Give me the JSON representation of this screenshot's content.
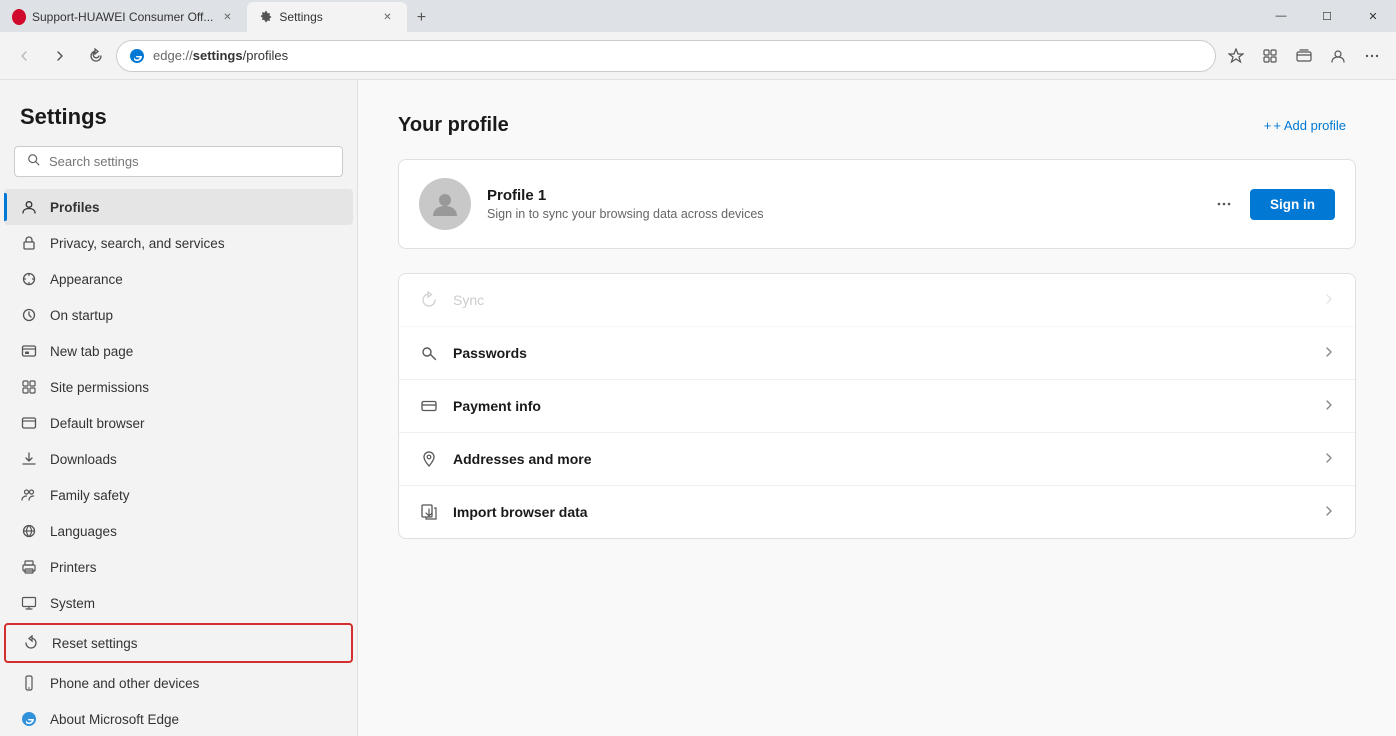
{
  "titlebar": {
    "tabs": [
      {
        "id": "tab-huawei",
        "label": "Support-HUAWEI Consumer Off...",
        "favicon_type": "huawei",
        "active": false
      },
      {
        "id": "tab-settings",
        "label": "Settings",
        "favicon_type": "settings",
        "active": true
      }
    ],
    "new_tab_label": "+",
    "window_controls": {
      "minimize": "—",
      "maximize": "☐",
      "close": "✕"
    }
  },
  "toolbar": {
    "back_disabled": true,
    "forward_disabled": false,
    "refresh_label": "↺",
    "address": "edge://settings/profiles",
    "address_protocol": "edge://",
    "address_path": "settings",
    "address_rest": "/profiles",
    "star_label": "☆",
    "collections_label": "⊞",
    "wallet_label": "◈",
    "profile_label": "◯",
    "more_label": "..."
  },
  "sidebar": {
    "title": "Settings",
    "search_placeholder": "Search settings",
    "nav_items": [
      {
        "id": "profiles",
        "label": "Profiles",
        "icon": "person",
        "active": true
      },
      {
        "id": "privacy",
        "label": "Privacy, search, and services",
        "icon": "lock"
      },
      {
        "id": "appearance",
        "label": "Appearance",
        "icon": "appearance"
      },
      {
        "id": "startup",
        "label": "On startup",
        "icon": "startup"
      },
      {
        "id": "newtab",
        "label": "New tab page",
        "icon": "newtab"
      },
      {
        "id": "sitepermissions",
        "label": "Site permissions",
        "icon": "siteperm"
      },
      {
        "id": "defaultbrowser",
        "label": "Default browser",
        "icon": "browser"
      },
      {
        "id": "downloads",
        "label": "Downloads",
        "icon": "download"
      },
      {
        "id": "familysafety",
        "label": "Family safety",
        "icon": "family"
      },
      {
        "id": "languages",
        "label": "Languages",
        "icon": "languages"
      },
      {
        "id": "printers",
        "label": "Printers",
        "icon": "printer"
      },
      {
        "id": "system",
        "label": "System",
        "icon": "system"
      },
      {
        "id": "resetsettings",
        "label": "Reset settings",
        "icon": "reset",
        "highlighted": true
      },
      {
        "id": "phonedevices",
        "label": "Phone and other devices",
        "icon": "phone"
      },
      {
        "id": "aboutedge",
        "label": "About Microsoft Edge",
        "icon": "edge"
      }
    ]
  },
  "content": {
    "page_title": "Your profile",
    "add_profile_label": "+ Add profile",
    "profile": {
      "name": "Profile 1",
      "description": "Sign in to sync your browsing data across devices",
      "sign_in_label": "Sign in"
    },
    "options": [
      {
        "id": "sync",
        "label": "Sync",
        "disabled": true
      },
      {
        "id": "passwords",
        "label": "Passwords",
        "disabled": false
      },
      {
        "id": "payment",
        "label": "Payment info",
        "disabled": false
      },
      {
        "id": "addresses",
        "label": "Addresses and more",
        "disabled": false
      },
      {
        "id": "import",
        "label": "Import browser data",
        "disabled": false
      }
    ]
  }
}
